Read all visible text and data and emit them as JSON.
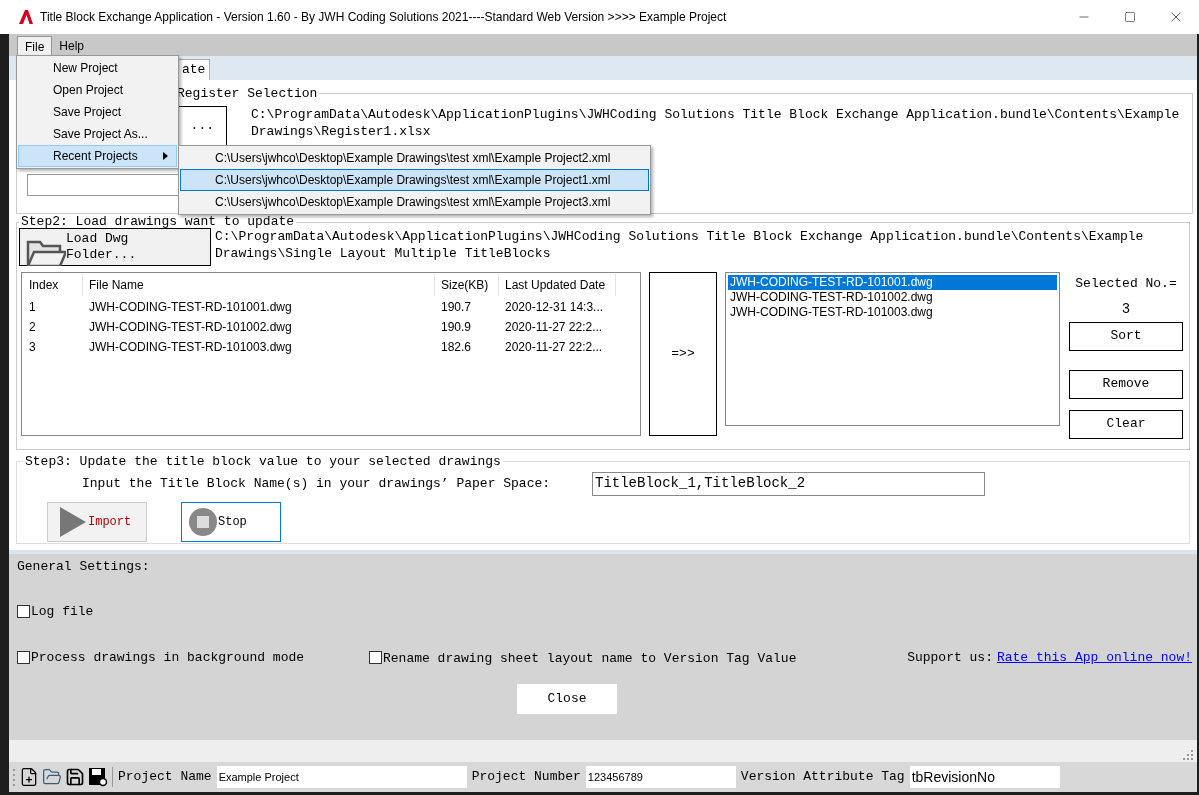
{
  "window": {
    "title": "Title Block Exchange Application - Version 1.60 - By JWH Coding Solutions 2021----Standard Web Version >>>> Example Project"
  },
  "menu_bar": [
    {
      "label": "File",
      "selected": true
    },
    {
      "label": "Help",
      "selected": false
    }
  ],
  "file_menu": [
    {
      "label": "New Project",
      "selected": false,
      "kind": "item"
    },
    {
      "label": "Open Project",
      "selected": false,
      "kind": "item"
    },
    {
      "label": "Save Project",
      "selected": false,
      "kind": "item"
    },
    {
      "label": "Save Project As...",
      "selected": false,
      "kind": "item"
    },
    {
      "label": "Recent Projects",
      "selected": true,
      "kind": "submenu"
    }
  ],
  "recent_projects": [
    {
      "label": "C:\\Users\\jwhco\\Desktop\\Example Drawings\\test xml\\Example Project2.xml",
      "selected": false
    },
    {
      "label": "C:\\Users\\jwhco\\Desktop\\Example Drawings\\test xml\\Example Project1.xml",
      "selected": true
    },
    {
      "label": "C:\\Users\\jwhco\\Desktop\\Example Drawings\\test xml\\Example Project3.xml",
      "selected": false
    }
  ],
  "tab": {
    "label": "ate"
  },
  "step1": {
    "legend": "Register Selection",
    "button_label": "...",
    "path": "C:\\ProgramData\\Autodesk\\ApplicationPlugins\\JWHCoding Solutions Title Block Exchange Application.bundle\\Contents\\Example Drawings\\Register1.xlsx"
  },
  "step2": {
    "legend": "Step2: Load drawings want to update",
    "load_button": "Load Dwg Folder...",
    "path": "C:\\ProgramData\\Autodesk\\ApplicationPlugins\\JWHCoding Solutions Title Block Exchange Application.bundle\\Contents\\Example Drawings\\Single Layout Multiple TitleBlocks",
    "table": {
      "columns": [
        "Index",
        "File Name",
        "Size(KB)",
        "Last Updated Date"
      ],
      "rows": [
        [
          "1",
          "JWH-CODING-TEST-RD-101001.dwg",
          "190.7",
          "2020-12-31 14:3..."
        ],
        [
          "2",
          "JWH-CODING-TEST-RD-101002.dwg",
          "190.9",
          "2020-11-27 22:2..."
        ],
        [
          "3",
          "JWH-CODING-TEST-RD-101003.dwg",
          "182.6",
          "2020-11-27 22:2..."
        ]
      ]
    },
    "transfer_button": "=>>",
    "selected_list": [
      {
        "label": "JWH-CODING-TEST-RD-101001.dwg",
        "selected": true
      },
      {
        "label": "JWH-CODING-TEST-RD-101002.dwg",
        "selected": false
      },
      {
        "label": "JWH-CODING-TEST-RD-101003.dwg",
        "selected": false
      }
    ],
    "selected_count_label": "Selected No.=",
    "selected_count": "3",
    "buttons": [
      "Sort",
      "Remove",
      "Clear"
    ]
  },
  "step3": {
    "legend": "Step3: Update the title block value to your selected drawings",
    "prompt": "Input the Title Block Name(s) in your drawings’ Paper Space:",
    "value": "TitleBlock_1,TitleBlock_2",
    "import_button": "Import",
    "stop_button": "Stop"
  },
  "general": {
    "heading": "General Settings:",
    "options": [
      {
        "label": "Log file",
        "checked": false
      },
      {
        "label": "Process drawings in background mode",
        "checked": false
      },
      {
        "label": "Rename drawing sheet layout name to Version Tag Value",
        "checked": false
      }
    ],
    "support_label": "Support us:",
    "support_link": "Rate this App online now!",
    "close_button": "Close"
  },
  "toolbar": {
    "fields": [
      {
        "label": "Project Name",
        "value": "Example Project"
      },
      {
        "label": "Project Number",
        "value": "123456789"
      },
      {
        "label": "Version Attribute Tag",
        "value": "tbRevisionNo"
      }
    ]
  }
}
